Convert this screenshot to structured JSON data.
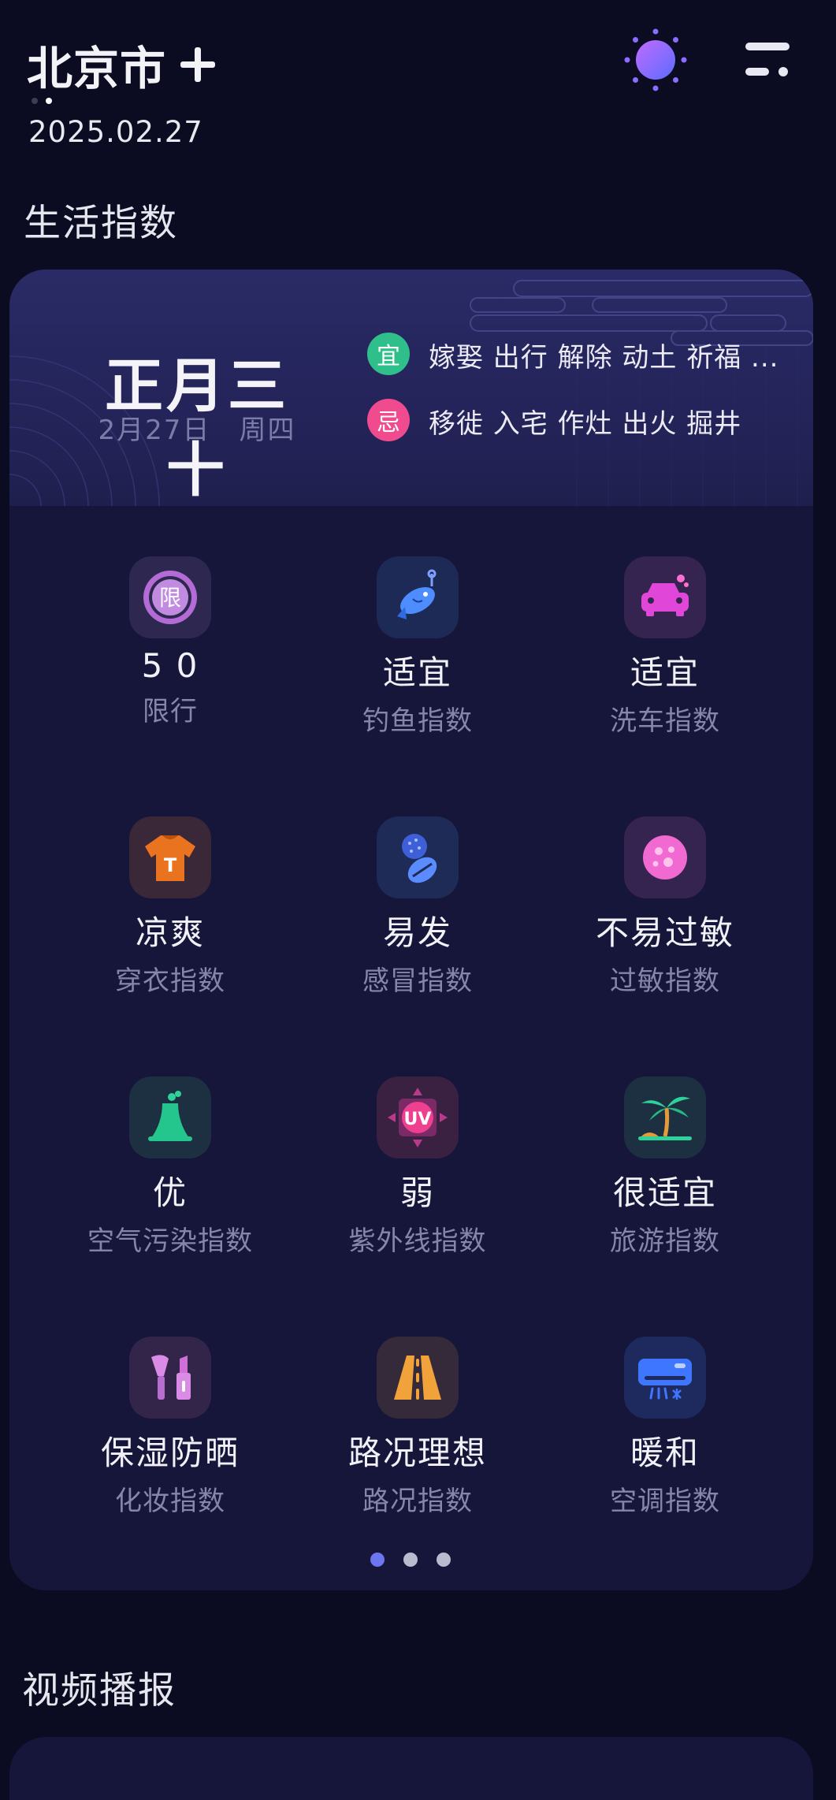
{
  "header": {
    "city": "北京市",
    "date": "2025.02.27"
  },
  "sections": {
    "life_index_title": "生活指数",
    "video_title": "视频播报"
  },
  "almanac": {
    "lunar_date": "正月三十",
    "solar_date": "2月27日　周四",
    "yi_badge": "宜",
    "yi_text": "嫁娶 出行 解除 动土 祈福 ...",
    "ji_badge": "忌",
    "ji_text": "移徙 入宅 作灶 出火 掘井"
  },
  "indices": [
    {
      "value": "5 0",
      "label": "限行",
      "icon": "restriction-icon",
      "icon_text": "限"
    },
    {
      "value": "适宜",
      "label": "钓鱼指数",
      "icon": "fishing-icon"
    },
    {
      "value": "适宜",
      "label": "洗车指数",
      "icon": "car-wash-icon"
    },
    {
      "value": "凉爽",
      "label": "穿衣指数",
      "icon": "clothing-icon",
      "icon_text": "T"
    },
    {
      "value": "易发",
      "label": "感冒指数",
      "icon": "cold-medicine-icon"
    },
    {
      "value": "不易过敏",
      "label": "过敏指数",
      "icon": "allergy-icon"
    },
    {
      "value": "优",
      "label": "空气污染指数",
      "icon": "air-pollution-icon"
    },
    {
      "value": "弱",
      "label": "紫外线指数",
      "icon": "uv-icon",
      "icon_text": "UV"
    },
    {
      "value": "很适宜",
      "label": "旅游指数",
      "icon": "travel-icon"
    },
    {
      "value": "保湿防晒",
      "label": "化妆指数",
      "icon": "makeup-icon"
    },
    {
      "value": "路况理想",
      "label": "路况指数",
      "icon": "road-icon"
    },
    {
      "value": "暖和",
      "label": "空调指数",
      "icon": "air-conditioner-icon"
    }
  ],
  "pager": {
    "pages": 3,
    "active": 1
  },
  "colors": {
    "background": "#0b0b22",
    "card": "#16163a",
    "yi": "#2fbf8a",
    "ji": "#ef4b8e",
    "pager_active": "#6d75f0"
  }
}
